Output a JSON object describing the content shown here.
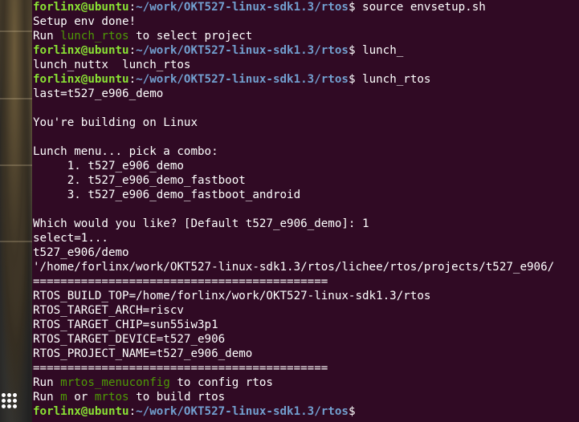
{
  "colors": {
    "background": "#300a24",
    "text": "#ffffff",
    "user_host": "#8ae234",
    "path": "#729fcf",
    "command_highlight": "#4e9a06"
  },
  "dock": {
    "app_grid_icon": "show-applications-icon"
  },
  "terminal": {
    "prompt": {
      "user_host": "forlinx@ubuntu",
      "colon": ":",
      "path": "~/work/OKT527-linux-sdk1.3/rtos",
      "symbol": "$"
    },
    "cmd1": " source envsetup.sh",
    "setup_done": "Setup env done!",
    "run_lunch": {
      "pre": "Run ",
      "cmd": "lunch_rtos",
      "post": " to select project"
    },
    "cmd2": " lunch_",
    "completions": "lunch_nuttx  lunch_rtos",
    "cmd3": " lunch_rtos",
    "last": "last=t527_e906_demo",
    "building": "You're building on Linux",
    "menu_title": "Lunch menu... pick a combo:",
    "menu_items": [
      "     1. t527_e906_demo",
      "     2. t527_e906_demo_fastboot",
      "     3. t527_e906_demo_fastboot_android"
    ],
    "which": "Which would you like? [Default t527_e906_demo]: 1",
    "select": "select=1...",
    "demo_path": "t527_e906/demo",
    "long_path": "'/home/forlinx/work/OKT527-linux-sdk1.3/rtos/lichee/rtos/projects/t527_e906/",
    "separator": "===========================================",
    "env": [
      "RTOS_BUILD_TOP=/home/forlinx/work/OKT527-linux-sdk1.3/rtos",
      "RTOS_TARGET_ARCH=riscv",
      "RTOS_TARGET_CHIP=sun55iw3p1",
      "RTOS_TARGET_DEVICE=t527_e906",
      "RTOS_PROJECT_NAME=t527_e906_demo"
    ],
    "run_menuconfig": {
      "pre": "Run ",
      "cmd": "mrtos_menuconfig",
      "post": " to config rtos"
    },
    "run_build": {
      "pre": "Run ",
      "cmd1": "m",
      "mid": " or ",
      "cmd2": "mrtos",
      "post": " to build rtos"
    }
  }
}
